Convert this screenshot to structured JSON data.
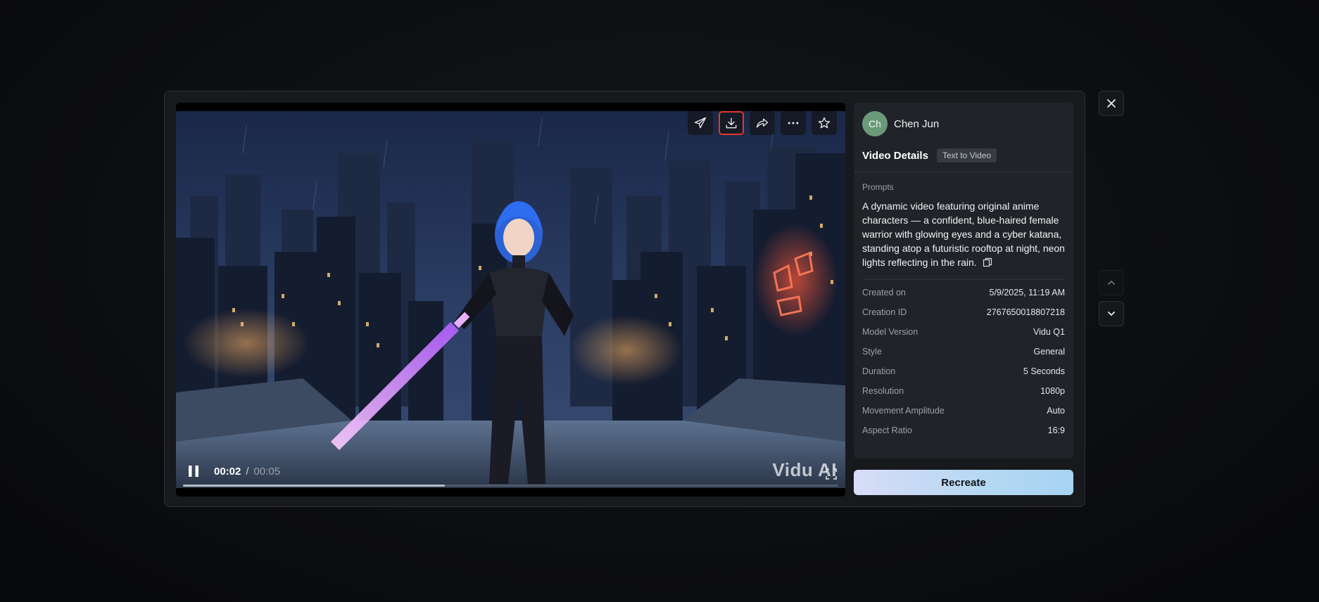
{
  "player": {
    "current_time": "00:02",
    "separator": "/",
    "total_time": "00:05",
    "progress_fraction": 0.4,
    "watermark": "Vidu AI",
    "toolbar": [
      {
        "icon": "send-icon"
      },
      {
        "icon": "download-icon",
        "highlighted": true
      },
      {
        "icon": "share-icon"
      },
      {
        "icon": "more-icon"
      },
      {
        "icon": "star-icon"
      }
    ]
  },
  "user": {
    "initials": "Ch",
    "name": "Chen Jun",
    "avatar_color": "#6a9a7a"
  },
  "details": {
    "title": "Video Details",
    "badge": "Text to Video",
    "prompt_label": "Prompts",
    "prompt_text": "A dynamic video featuring original anime characters — a confident, blue-haired female warrior with glowing eyes and a cyber katana, standing atop a futuristic rooftop at night, neon lights reflecting in the rain.",
    "rows": [
      {
        "key": "Created on",
        "value": "5/9/2025, 11:19 AM"
      },
      {
        "key": "Creation ID",
        "value": "2767650018807218"
      },
      {
        "key": "Model Version",
        "value": "Vidu Q1"
      },
      {
        "key": "Style",
        "value": "General"
      },
      {
        "key": "Duration",
        "value": "5 Seconds"
      },
      {
        "key": "Resolution",
        "value": "1080p"
      },
      {
        "key": "Movement Amplitude",
        "value": "Auto"
      },
      {
        "key": "Aspect Ratio",
        "value": "16:9"
      }
    ]
  },
  "actions": {
    "recreate_label": "Recreate"
  },
  "colors": {
    "highlight": "#e1372c",
    "recreate_gradient_start": "#d9dcf7",
    "recreate_gradient_end": "#a6d4f2"
  }
}
